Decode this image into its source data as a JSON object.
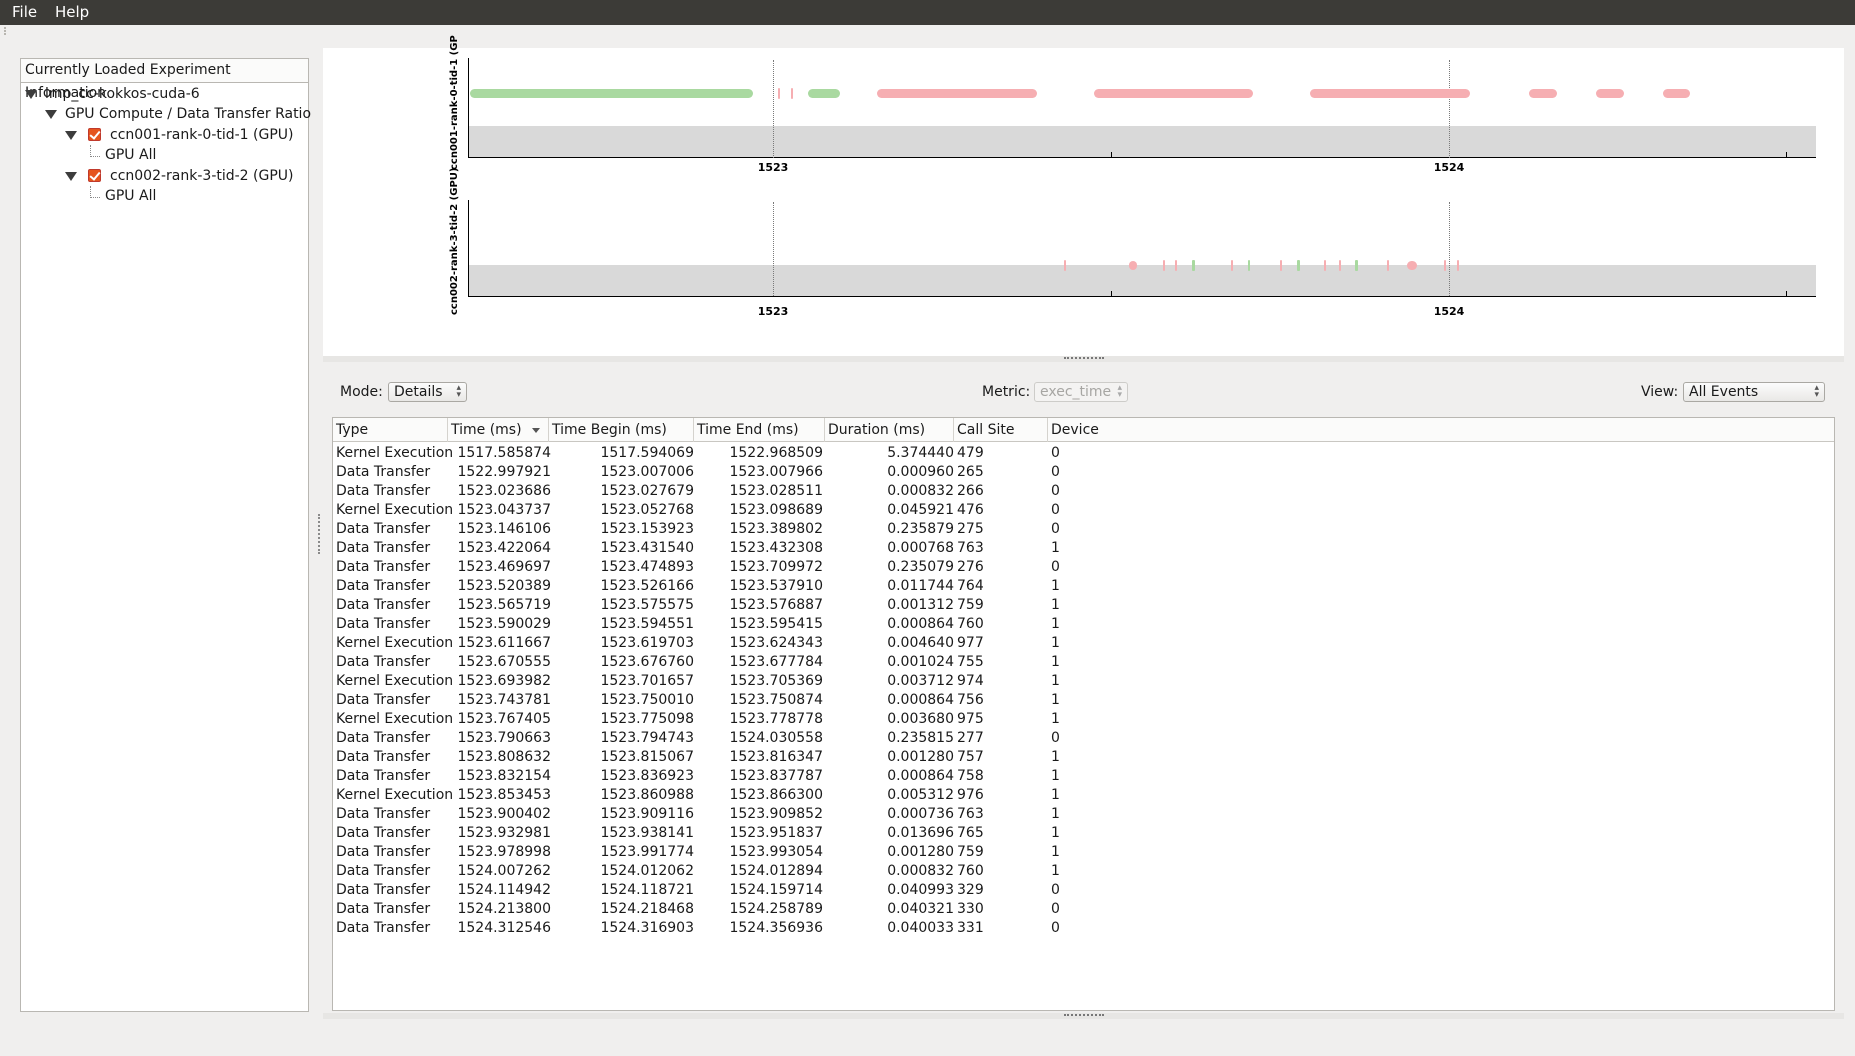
{
  "menubar": {
    "file": "File",
    "help": "Help"
  },
  "tree": {
    "header": "Currently Loaded Experiment Information",
    "experiment": "lmp_cc-kokkos-cuda-6",
    "view": "GPU Compute / Data Transfer Ratio",
    "nodes": [
      {
        "label": "ccn001-rank-0-tid-1 (GPU)",
        "child": "GPU All",
        "checked": true
      },
      {
        "label": "ccn002-rank-3-tid-2 (GPU)",
        "child": "GPU All",
        "checked": true
      }
    ]
  },
  "timeline": {
    "colors": {
      "compute": "#a9d9a0",
      "transfer": "#f6aeb2",
      "band": "#d9d9d9"
    },
    "tracks": [
      {
        "label": "ccn001-rank-0-tid-1 (GP",
        "ticks": [
          "1523",
          "1524"
        ],
        "segments": [
          {
            "kind": "compute",
            "start": 1522.55,
            "end": 1522.97
          },
          {
            "kind": "transfer",
            "start": 1523.007,
            "end": 1523.009
          },
          {
            "kind": "transfer",
            "start": 1523.027,
            "end": 1523.029
          },
          {
            "kind": "compute",
            "start": 1523.052,
            "end": 1523.099
          },
          {
            "kind": "transfer",
            "start": 1523.154,
            "end": 1523.39
          },
          {
            "kind": "transfer",
            "start": 1523.475,
            "end": 1523.71
          },
          {
            "kind": "transfer",
            "start": 1523.795,
            "end": 1524.031
          },
          {
            "kind": "transfer",
            "start": 1524.119,
            "end": 1524.16
          },
          {
            "kind": "transfer",
            "start": 1524.218,
            "end": 1524.259
          },
          {
            "kind": "transfer",
            "start": 1524.317,
            "end": 1524.357
          }
        ]
      },
      {
        "label": "ccn002-rank-3-tid-2 (GPU)",
        "ticks": [
          "1523",
          "1524"
        ],
        "segments": [
          {
            "kind": "transfer",
            "start": 1523.431,
            "end": 1523.433
          },
          {
            "kind": "transfer",
            "start": 1523.526,
            "end": 1523.538
          },
          {
            "kind": "transfer",
            "start": 1523.577,
            "end": 1523.578
          },
          {
            "kind": "transfer",
            "start": 1523.595,
            "end": 1523.596
          },
          {
            "kind": "compute",
            "start": 1523.62,
            "end": 1523.624
          },
          {
            "kind": "transfer",
            "start": 1523.677,
            "end": 1523.678
          },
          {
            "kind": "compute",
            "start": 1523.702,
            "end": 1523.705
          },
          {
            "kind": "transfer",
            "start": 1523.75,
            "end": 1523.751
          },
          {
            "kind": "compute",
            "start": 1523.775,
            "end": 1523.779
          },
          {
            "kind": "transfer",
            "start": 1523.815,
            "end": 1523.816
          },
          {
            "kind": "transfer",
            "start": 1523.837,
            "end": 1523.838
          },
          {
            "kind": "compute",
            "start": 1523.861,
            "end": 1523.866
          },
          {
            "kind": "transfer",
            "start": 1523.909,
            "end": 1523.91
          },
          {
            "kind": "transfer",
            "start": 1523.938,
            "end": 1523.952
          },
          {
            "kind": "transfer",
            "start": 1523.992,
            "end": 1523.993
          },
          {
            "kind": "transfer",
            "start": 1524.012,
            "end": 1524.013
          }
        ]
      }
    ]
  },
  "controls": {
    "mode_label": "Mode:",
    "mode_value": "Details",
    "metric_label": "Metric:",
    "metric_value": "exec_time",
    "view_label": "View:",
    "view_value": "All Events"
  },
  "table": {
    "columns": [
      "Type",
      "Time (ms)",
      "Time Begin (ms)",
      "Time End (ms)",
      "Duration (ms)",
      "Call Site",
      "Device"
    ],
    "rows": [
      [
        "Kernel Execution",
        "1517.585874",
        "1517.594069",
        "1522.968509",
        "5.374440",
        "479",
        "0"
      ],
      [
        "Data Transfer",
        "1522.997921",
        "1523.007006",
        "1523.007966",
        "0.000960",
        "265",
        "0"
      ],
      [
        "Data Transfer",
        "1523.023686",
        "1523.027679",
        "1523.028511",
        "0.000832",
        "266",
        "0"
      ],
      [
        "Kernel Execution",
        "1523.043737",
        "1523.052768",
        "1523.098689",
        "0.045921",
        "476",
        "0"
      ],
      [
        "Data Transfer",
        "1523.146106",
        "1523.153923",
        "1523.389802",
        "0.235879",
        "275",
        "0"
      ],
      [
        "Data Transfer",
        "1523.422064",
        "1523.431540",
        "1523.432308",
        "0.000768",
        "763",
        "1"
      ],
      [
        "Data Transfer",
        "1523.469697",
        "1523.474893",
        "1523.709972",
        "0.235079",
        "276",
        "0"
      ],
      [
        "Data Transfer",
        "1523.520389",
        "1523.526166",
        "1523.537910",
        "0.011744",
        "764",
        "1"
      ],
      [
        "Data Transfer",
        "1523.565719",
        "1523.575575",
        "1523.576887",
        "0.001312",
        "759",
        "1"
      ],
      [
        "Data Transfer",
        "1523.590029",
        "1523.594551",
        "1523.595415",
        "0.000864",
        "760",
        "1"
      ],
      [
        "Kernel Execution",
        "1523.611667",
        "1523.619703",
        "1523.624343",
        "0.004640",
        "977",
        "1"
      ],
      [
        "Data Transfer",
        "1523.670555",
        "1523.676760",
        "1523.677784",
        "0.001024",
        "755",
        "1"
      ],
      [
        "Kernel Execution",
        "1523.693982",
        "1523.701657",
        "1523.705369",
        "0.003712",
        "974",
        "1"
      ],
      [
        "Data Transfer",
        "1523.743781",
        "1523.750010",
        "1523.750874",
        "0.000864",
        "756",
        "1"
      ],
      [
        "Kernel Execution",
        "1523.767405",
        "1523.775098",
        "1523.778778",
        "0.003680",
        "975",
        "1"
      ],
      [
        "Data Transfer",
        "1523.790663",
        "1523.794743",
        "1524.030558",
        "0.235815",
        "277",
        "0"
      ],
      [
        "Data Transfer",
        "1523.808632",
        "1523.815067",
        "1523.816347",
        "0.001280",
        "757",
        "1"
      ],
      [
        "Data Transfer",
        "1523.832154",
        "1523.836923",
        "1523.837787",
        "0.000864",
        "758",
        "1"
      ],
      [
        "Kernel Execution",
        "1523.853453",
        "1523.860988",
        "1523.866300",
        "0.005312",
        "976",
        "1"
      ],
      [
        "Data Transfer",
        "1523.900402",
        "1523.909116",
        "1523.909852",
        "0.000736",
        "763",
        "1"
      ],
      [
        "Data Transfer",
        "1523.932981",
        "1523.938141",
        "1523.951837",
        "0.013696",
        "765",
        "1"
      ],
      [
        "Data Transfer",
        "1523.978998",
        "1523.991774",
        "1523.993054",
        "0.001280",
        "759",
        "1"
      ],
      [
        "Data Transfer",
        "1524.007262",
        "1524.012062",
        "1524.012894",
        "0.000832",
        "760",
        "1"
      ],
      [
        "Data Transfer",
        "1524.114942",
        "1524.118721",
        "1524.159714",
        "0.040993",
        "329",
        "0"
      ],
      [
        "Data Transfer",
        "1524.213800",
        "1524.218468",
        "1524.258789",
        "0.040321",
        "330",
        "0"
      ],
      [
        "Data Transfer",
        "1524.312546",
        "1524.316903",
        "1524.356936",
        "0.040033",
        "331",
        "0"
      ]
    ]
  }
}
